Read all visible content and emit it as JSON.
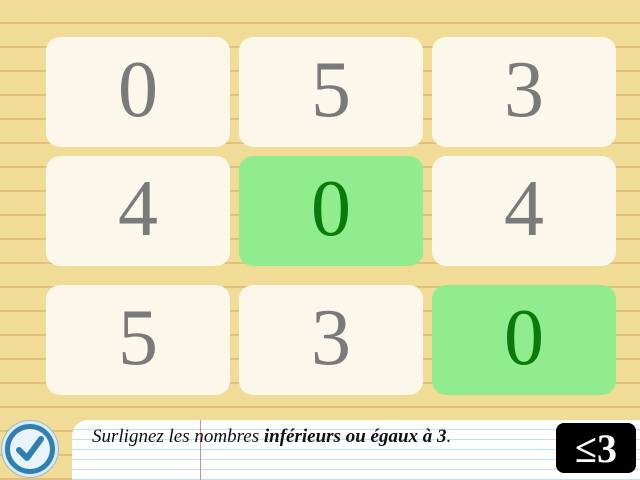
{
  "grid": {
    "rows": [
      [
        {
          "value": "0",
          "selected": false
        },
        {
          "value": "5",
          "selected": false
        },
        {
          "value": "3",
          "selected": false
        }
      ],
      [
        {
          "value": "4",
          "selected": false
        },
        {
          "value": "0",
          "selected": true
        },
        {
          "value": "4",
          "selected": false
        }
      ],
      [
        {
          "value": "5",
          "selected": false
        },
        {
          "value": "3",
          "selected": false
        },
        {
          "value": "0",
          "selected": true
        }
      ]
    ]
  },
  "instruction": {
    "prefix": "Surlignez les nombres ",
    "emphasis": "inférieurs ou égaux à 3",
    "suffix": "."
  },
  "rule_badge": "≤3",
  "check_button": {
    "icon": "checkmark-icon"
  },
  "colors": {
    "background": "#f1dc97",
    "tile": "#fbf7eb",
    "tile_selected": "#90ec8c",
    "digit": "#7a7a7a",
    "digit_selected": "#0a7a0a",
    "check_button": "#2f7fb3"
  }
}
